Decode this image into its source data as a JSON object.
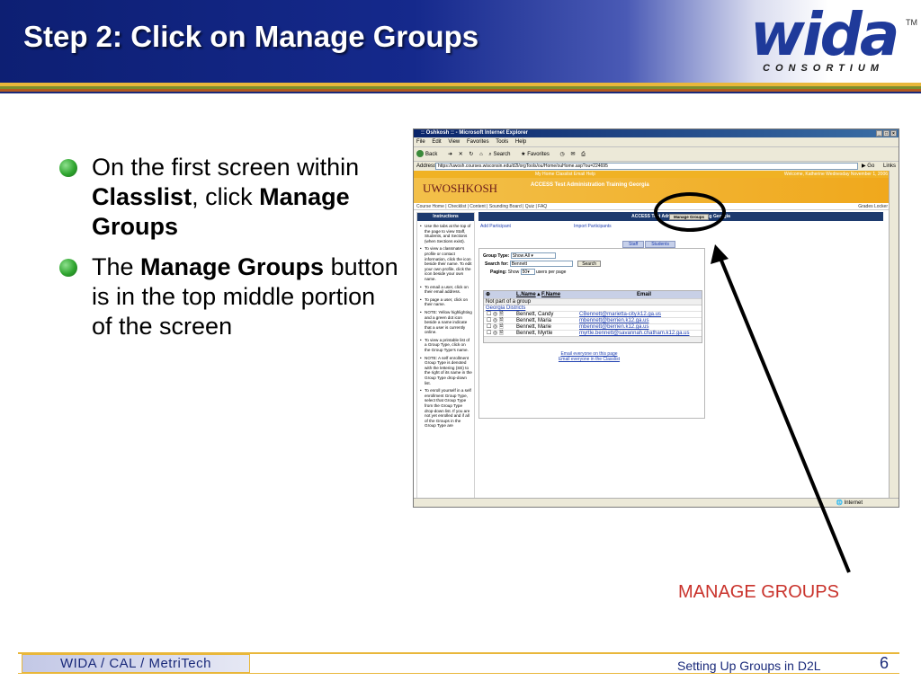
{
  "slide": {
    "title": "Step 2: Click on Manage Groups",
    "logo": {
      "word": "wida",
      "sub": "CONSORTIUM",
      "tm": "TM"
    },
    "bullets": [
      {
        "pre": "On the first screen within ",
        "bold1": "Classlist",
        "mid": ", click ",
        "bold2": "Manage Groups",
        "post": ""
      },
      {
        "pre": "The ",
        "bold1": "Manage Groups",
        "mid": " button is in the top middle portion of the screen",
        "bold2": "",
        "post": ""
      }
    ],
    "annotation_label": "MANAGE GROUPS",
    "footer": {
      "left": "WIDA / CAL / MetriTech",
      "center": "Setting Up Groups in D2L",
      "page": "6"
    },
    "colors": {
      "header_blue": "#0d1f73",
      "bullet_green": "#2fa52f",
      "annotation_red": "#c9322b",
      "gold": "#e9b73a"
    }
  },
  "browser": {
    "title": ":: Oshkosh :: - Microsoft Internet Explorer",
    "menu": [
      "File",
      "Edit",
      "View",
      "Favorites",
      "Tools",
      "Help"
    ],
    "toolbar": [
      "Back",
      "Search",
      "Favorites"
    ],
    "address_label": "Address",
    "address": "https://uwosh.courses.wisconsin.edu/d2l/orgTools/ou/Home/ouHome.asp?ou=224695",
    "go": "Go",
    "links": "Links",
    "status": "Internet",
    "page": {
      "quicklinks": "My Home  Classlist  Email  Help",
      "welcome": "Welcome, Katherine  Wednesday November 1, 2006",
      "logo_text": "UWOSHKOSH",
      "org_title": "ACCESS Test Administration Training Georgia",
      "nav": "Course Home | Checklist | Content | Sounding Board | Quiz | FAQ",
      "nav_right": "Grades  Locker",
      "instructions_title": "Instructions",
      "instructions": [
        "Use the tabs at the top of the page to view Staff, Students, and Sections (when Sections exist).",
        "To view a classmate's profile or contact information, click the icon beside their name. To edit your own profile, click the icon beside your own name.",
        "To email a user, click on their email address.",
        "To page a user, click on their name.",
        "NOTE: Yellow highlighting and a green dot icon beside a name indicate that a user is currently online.",
        "To view a printable list of a Group Type, click on the Group Type's name.",
        "NOTE: A self enrollment Group Type is denoted with the lettering (SE) to the right of its name in the Group Type drop-down list.",
        "To enroll yourself in a self enrollment Group Type, select that Group Type from the Group Type drop-down list. If you are not yet enrolled and if all of the Groups in the Group Type are"
      ],
      "main_title": "ACCESS Test Administration Training Georgia",
      "manage_groups_button": "Manage Groups",
      "add_participant": "Add Participant",
      "import_participants": "Import Participants",
      "tabs": [
        "Staff",
        "Students"
      ],
      "filter": {
        "group_type_label": "Group Type:",
        "group_type_value": "Show All",
        "search_label": "Search for:",
        "search_value": "Bennett",
        "search_button": "Search",
        "paging_label": "Paging:",
        "paging_show": "Show",
        "paging_value": "50",
        "paging_suffix": "users per page"
      },
      "table": {
        "headers": [
          "L.Name",
          "F.Name",
          "Email"
        ],
        "group_header": "Not part of a group",
        "group_link": "Georgia Districts",
        "rows": [
          {
            "name": "Bennett, Candy",
            "email": "CBennett@marietta-city.k12.ga.us"
          },
          {
            "name": "Bennett, Maria",
            "email": "mbennett@berrien.k12.ga.us"
          },
          {
            "name": "Bennett, Marie",
            "email": "mbennett@berrien.k12.ga.us"
          },
          {
            "name": "Bennett, Myrtle",
            "email": "myrtle.bennett@savannah.chatham.k12.ga.us"
          }
        ]
      },
      "email_links": [
        "Email everyone on this page",
        "Email everyone in the Classlist"
      ]
    }
  }
}
